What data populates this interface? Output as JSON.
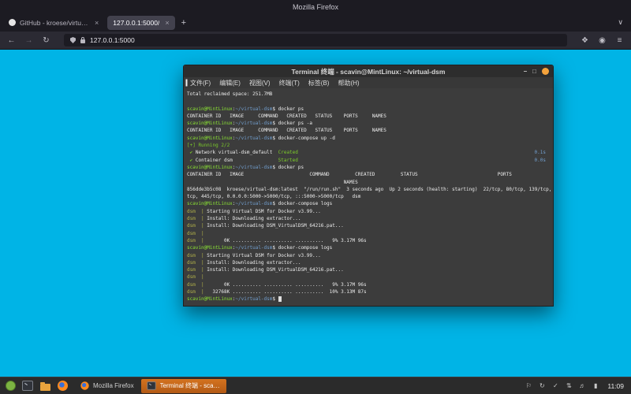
{
  "colors": {
    "page_background": "#00b4e6",
    "terminal_background": "#3c3c3c",
    "prompt_green": "#8ae234",
    "path_blue": "#729fcf",
    "active_taskbar_button_orange": "#c96a1f",
    "terminal_close_button_orange": "#f5a33c"
  },
  "firefox": {
    "titlebar_title": "Mozilla Firefox",
    "new_tab_glyph": "+",
    "list_tabs_glyph": "∨",
    "close_glyph": "×",
    "tabs": [
      {
        "label": "GitHub - kroese/virtual-dsm",
        "icon": "github",
        "active": false
      },
      {
        "label": "127.0.0.1:5000/",
        "icon": null,
        "active": true
      }
    ],
    "nav": {
      "back_glyph": "←",
      "forward_glyph": "→",
      "reload_glyph": "↻",
      "url": "127.0.0.1:5000",
      "extensions_glyph": "❖",
      "account_glyph": "◉",
      "menu_glyph": "≡"
    }
  },
  "terminal": {
    "title": "Terminal 终端 - scavin@MintLinux: ~/virtual-dsm",
    "controls": {
      "minimize": "–",
      "maximize": "□"
    },
    "menus": [
      "文件(F)",
      "编辑(E)",
      "视图(V)",
      "终端(T)",
      "标签(B)",
      "帮助(H)"
    ],
    "lines": [
      [
        {
          "t": "Total reclaimed space: 251.7MB",
          "c": "w"
        }
      ],
      [
        {
          "t": " ",
          "c": "w"
        }
      ],
      [
        {
          "t": "scavin@MintLinux",
          "c": "g"
        },
        {
          "t": ":",
          "c": "w"
        },
        {
          "t": "~/virtual-dsm",
          "c": "b"
        },
        {
          "t": "$ docker ps",
          "c": "w"
        }
      ],
      [
        {
          "t": "CONTAINER ID   IMAGE     COMMAND   CREATED   STATUS    PORTS     NAMES",
          "c": "w"
        }
      ],
      [
        {
          "t": "scavin@MintLinux",
          "c": "g"
        },
        {
          "t": ":",
          "c": "w"
        },
        {
          "t": "~/virtual-dsm",
          "c": "b"
        },
        {
          "t": "$ docker ps -a",
          "c": "w"
        }
      ],
      [
        {
          "t": "CONTAINER ID   IMAGE     COMMAND   CREATED   STATUS    PORTS     NAMES",
          "c": "w"
        }
      ],
      [
        {
          "t": "scavin@MintLinux",
          "c": "g"
        },
        {
          "t": ":",
          "c": "w"
        },
        {
          "t": "~/virtual-dsm",
          "c": "b"
        },
        {
          "t": "$ docker-compose up -d",
          "c": "w"
        }
      ],
      [
        {
          "t": "[+] Running 2/2",
          "c": "gr"
        }
      ],
      [
        {
          "t": " ✔",
          "c": "gr"
        },
        {
          "t": " Network virtual-dsm_default  ",
          "c": "w"
        },
        {
          "t": "Created",
          "c": "gr"
        },
        {
          "t": "0.1s",
          "c": "b",
          "r": true
        }
      ],
      [
        {
          "t": " ✔",
          "c": "gr"
        },
        {
          "t": " Container dsm                ",
          "c": "w"
        },
        {
          "t": "Started",
          "c": "gr"
        },
        {
          "t": "0.0s",
          "c": "b",
          "r": true
        }
      ],
      [
        {
          "t": "scavin@MintLinux",
          "c": "g"
        },
        {
          "t": ":",
          "c": "w"
        },
        {
          "t": "~/virtual-dsm",
          "c": "b"
        },
        {
          "t": "$ docker ps",
          "c": "w"
        }
      ],
      [
        {
          "t": "CONTAINER ID   IMAGE                       COMMAND         CREATED         STATUS                            PORTS",
          "c": "w"
        }
      ],
      [
        {
          "t": "                                                       NAMES",
          "c": "w"
        }
      ],
      [
        {
          "t": "856dde3b5c08  kroese/virtual-dsm:latest  \"/run/run.sh\"  3 seconds ago  Up 2 seconds (health: starting)  22/tcp, 80/tcp, 139/tcp, 443/",
          "c": "w"
        }
      ],
      [
        {
          "t": "tcp, 445/tcp, 0.0.0.0:5000->5000/tcp, :::5000->5000/tcp   dsm",
          "c": "w"
        }
      ],
      [
        {
          "t": "scavin@MintLinux",
          "c": "g"
        },
        {
          "t": ":",
          "c": "w"
        },
        {
          "t": "~/virtual-dsm",
          "c": "b"
        },
        {
          "t": "$ docker-compose logs",
          "c": "w"
        }
      ],
      [
        {
          "t": "dsm  |",
          "c": "y"
        },
        {
          "t": " Starting Virtual DSM for Docker v3.99...",
          "c": "w"
        }
      ],
      [
        {
          "t": "dsm  |",
          "c": "y"
        },
        {
          "t": " Install: Downloading extractor...",
          "c": "w"
        }
      ],
      [
        {
          "t": "dsm  |",
          "c": "y"
        },
        {
          "t": " Install: Downloading DSM_VirtualDSM_64216.pat...",
          "c": "w"
        }
      ],
      [
        {
          "t": "dsm  |",
          "c": "y"
        }
      ],
      [
        {
          "t": "dsm  |",
          "c": "y"
        },
        {
          "t": "       0K .......... .......... ..........   9% 3.17M 96s",
          "c": "w"
        }
      ],
      [
        {
          "t": "scavin@MintLinux",
          "c": "g"
        },
        {
          "t": ":",
          "c": "w"
        },
        {
          "t": "~/virtual-dsm",
          "c": "b"
        },
        {
          "t": "$ docker-compose logs",
          "c": "w"
        }
      ],
      [
        {
          "t": "dsm  |",
          "c": "y"
        },
        {
          "t": " Starting Virtual DSM for Docker v3.99...",
          "c": "w"
        }
      ],
      [
        {
          "t": "dsm  |",
          "c": "y"
        },
        {
          "t": " Install: Downloading extractor...",
          "c": "w"
        }
      ],
      [
        {
          "t": "dsm  |",
          "c": "y"
        },
        {
          "t": " Install: Downloading DSM_VirtualDSM_64216.pat...",
          "c": "w"
        }
      ],
      [
        {
          "t": "dsm  |",
          "c": "y"
        }
      ],
      [
        {
          "t": "dsm  |",
          "c": "y"
        },
        {
          "t": "       0K .......... .......... ..........   9% 3.17M 96s",
          "c": "w"
        }
      ],
      [
        {
          "t": "dsm  |",
          "c": "y"
        },
        {
          "t": "   32768K .......... .......... ..........  10% 3.13M 87s",
          "c": "w"
        }
      ],
      [
        {
          "t": "scavin@MintLinux",
          "c": "g"
        },
        {
          "t": ":",
          "c": "w"
        },
        {
          "t": "~/virtual-dsm",
          "c": "b"
        },
        {
          "t": "$ ",
          "c": "w"
        },
        {
          "t": " ",
          "c": "cur"
        }
      ]
    ]
  },
  "taskbar": {
    "launchers": [
      {
        "name": "mint-menu-icon",
        "type": "mint"
      },
      {
        "name": "terminal-launcher-icon",
        "type": "terminal"
      },
      {
        "name": "files-launcher-icon",
        "type": "files"
      },
      {
        "name": "firefox-launcher-icon",
        "type": "firefox"
      }
    ],
    "windows": [
      {
        "label": "Mozilla Firefox",
        "icon": "firefox",
        "active": false
      },
      {
        "label": "Terminal 终端 - scavin@Mi...",
        "icon": "terminal",
        "active": true
      }
    ],
    "tray": [
      {
        "name": "notifications-icon",
        "glyph": "⚐"
      },
      {
        "name": "updates-icon",
        "glyph": "↻"
      },
      {
        "name": "security-shield-icon",
        "glyph": "✓"
      },
      {
        "name": "network-icon",
        "glyph": "⇅"
      },
      {
        "name": "volume-icon",
        "glyph": "♬"
      },
      {
        "name": "power-icon",
        "glyph": "▮"
      }
    ],
    "clock": "11:09"
  }
}
